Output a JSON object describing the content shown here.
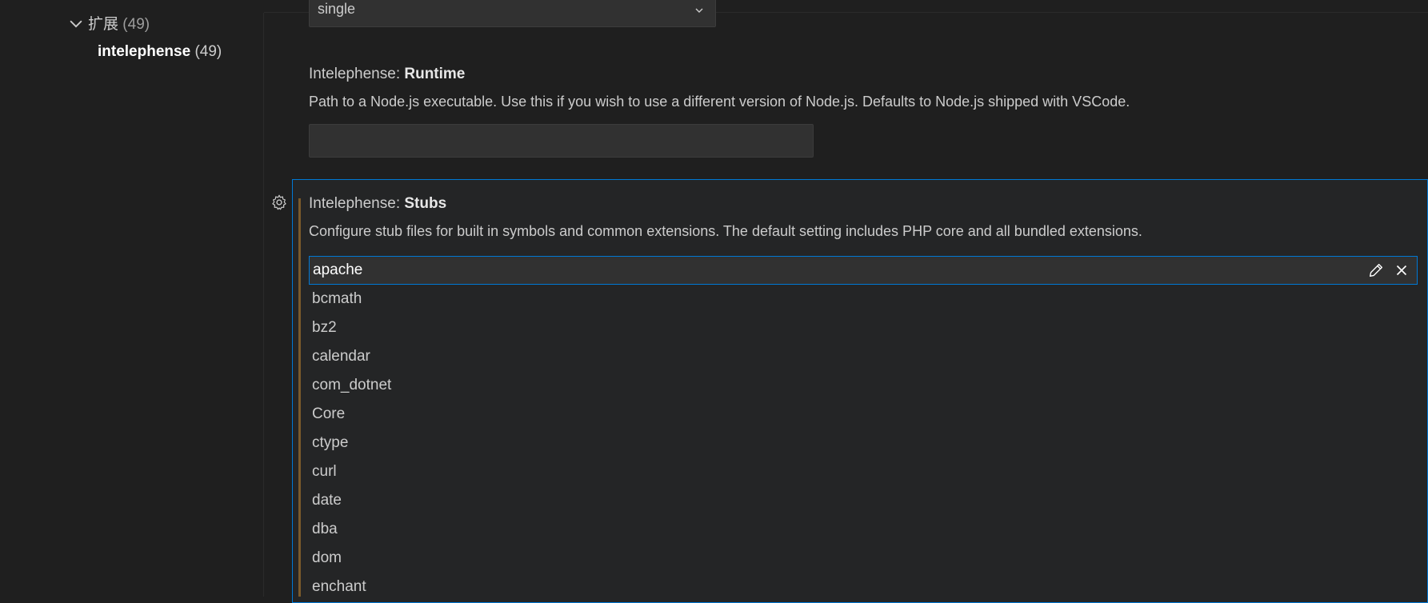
{
  "toc": {
    "extensions": {
      "label": "扩展",
      "count": "(49)"
    },
    "intelephense": {
      "label": "intelephense",
      "count": "(49)"
    }
  },
  "top_dropdown": {
    "value": "single"
  },
  "runtime": {
    "prefix": "Intelephense: ",
    "name": "Runtime",
    "description": "Path to a Node.js executable. Use this if you wish to use a different version of Node.js. Defaults to Node.js shipped with VSCode.",
    "value": ""
  },
  "stubs": {
    "prefix": "Intelephense: ",
    "name": "Stubs",
    "description": "Configure stub files for built in symbols and common extensions. The default setting includes PHP core and all bundled extensions.",
    "items": [
      "apache",
      "bcmath",
      "bz2",
      "calendar",
      "com_dotnet",
      "Core",
      "ctype",
      "curl",
      "date",
      "dba",
      "dom",
      "enchant"
    ]
  },
  "colors": {
    "accent": "#0078d4",
    "modified": "#7a5a2b",
    "background": "#1f1f1f"
  }
}
